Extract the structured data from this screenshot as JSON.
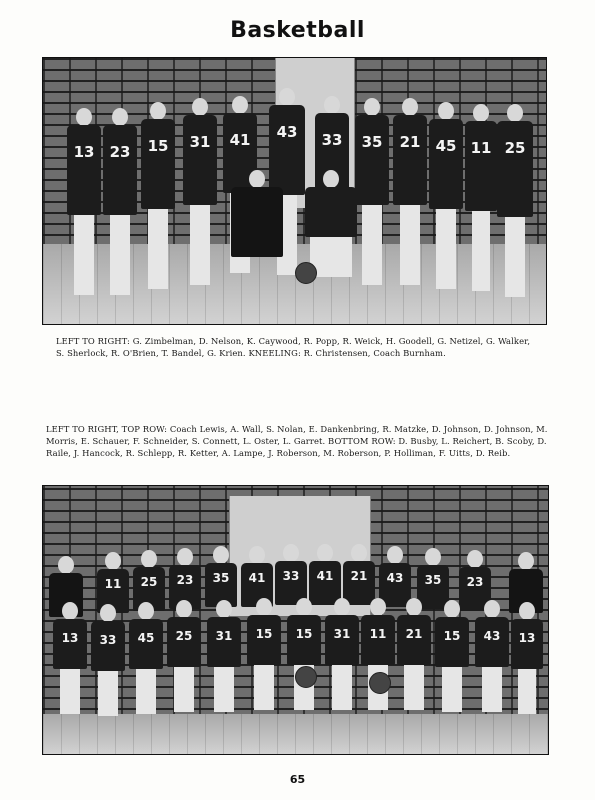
{
  "page": {
    "title": "Basketball",
    "page_number": "65"
  },
  "photos": {
    "top": {
      "caption": "LEFT TO RIGHT: G. Zimbelman, D. Nelson, K. Caywood, R. Popp, R. Weick, H. Goodell, G. Netizel, G. Walker, S. Sherlock, R. O'Brien, T. Bandel, G. Krien. KNEELING: R. Christensen, Coach Burnham.",
      "jersey_numbers": [
        "13",
        "23",
        "15",
        "31",
        "41",
        "43",
        "33",
        "35",
        "21",
        "45",
        "11",
        "25"
      ]
    },
    "bottom": {
      "caption": "LEFT TO RIGHT, TOP ROW: Coach Lewis, A. Wall, S. Nolan, E. Dankenbring, R. Matzke, D. Johnson, D. Johnson, M. Morris, E. Schauer, F. Schneider, S. Connett, L. Oster, L. Garret. BOTTOM ROW: D. Busby, L. Reichert, B. Scoby, D. Raile, J. Hancock, R. Schlepp, R. Ketter, A. Lampe, J. Roberson, M. Roberson, P. Holliman, F. Uitts, D. Reib.",
      "top_row_numbers": [
        "11",
        "25",
        "23",
        "35",
        "41",
        "33",
        "41",
        "21",
        "43",
        "35",
        "23"
      ],
      "bottom_row_numbers": [
        "13",
        "33",
        "45",
        "25",
        "31",
        "15",
        "15",
        "31",
        "11",
        "21",
        "15",
        "43",
        "13"
      ]
    }
  }
}
